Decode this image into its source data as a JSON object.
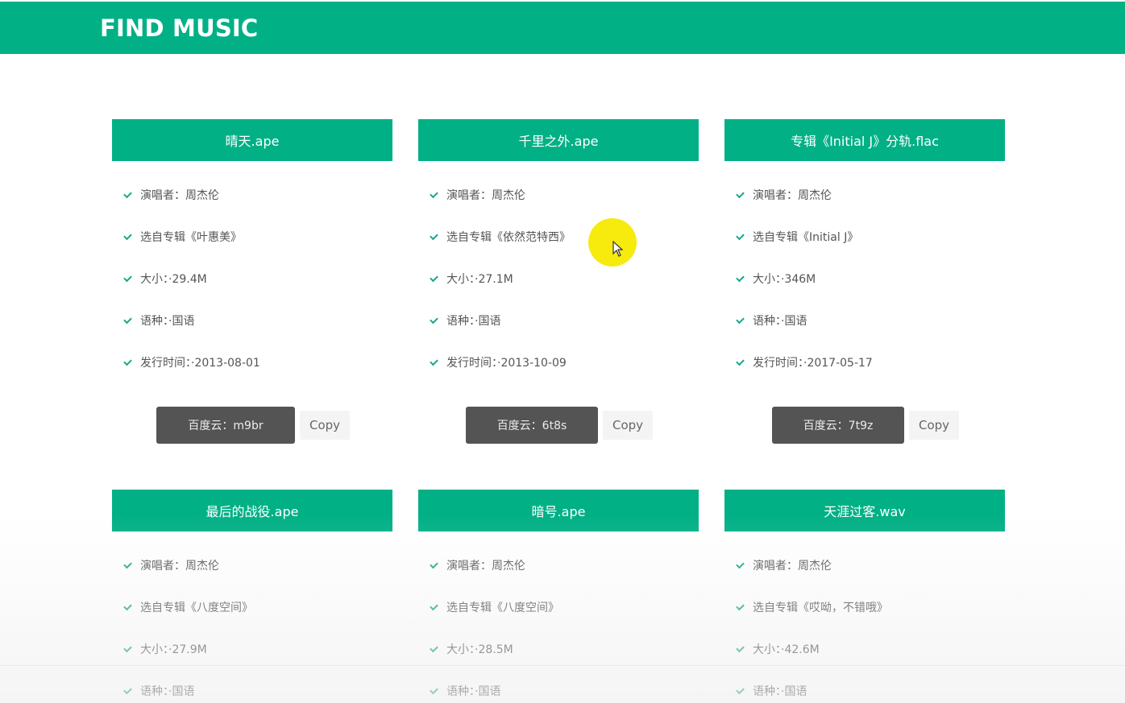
{
  "header": {
    "title": "FIND MUSIC"
  },
  "labels": {
    "singer": "演唱者：",
    "album_prefix": "选自专辑",
    "size": "大小：",
    "language": "语种：",
    "release": "发行时间：",
    "pan": "百度云：",
    "copy": "Copy"
  },
  "cards": [
    {
      "title": "晴天.ape",
      "singer": "演唱者：周杰伦",
      "album": "选自专辑《叶惠美》",
      "size": "大小：·29.4M",
      "language": "语种：·国语",
      "release": "发行时间：·2013-08-01",
      "pan_code": "百度云：m9br",
      "copy_label": "Copy"
    },
    {
      "title": "千里之外.ape",
      "singer": "演唱者：周杰伦",
      "album": "选自专辑《依然范特西》",
      "size": "大小：·27.1M",
      "language": "语种：·国语",
      "release": "发行时间：·2013-10-09",
      "pan_code": "百度云：6t8s",
      "copy_label": "Copy"
    },
    {
      "title": "专辑《Initial J》分轨.flac",
      "singer": "演唱者：周杰伦",
      "album": "选自专辑《Initial J》",
      "size": "大小：·346M",
      "language": "语种：·国语",
      "release": "发行时间：·2017-05-17",
      "pan_code": "百度云：7t9z",
      "copy_label": "Copy"
    },
    {
      "title": "最后的战役.ape",
      "singer": "演唱者：周杰伦",
      "album": "选自专辑《八度空间》",
      "size": "大小：·27.9M",
      "language": "语种：·国语"
    },
    {
      "title": "暗号.ape",
      "singer": "演唱者：周杰伦",
      "album": "选自专辑《八度空间》",
      "size": "大小：·28.5M",
      "language": "语种：·国语"
    },
    {
      "title": "天涯过客.wav",
      "singer": "演唱者：周杰伦",
      "album": "选自专辑《哎呦，不错哦》",
      "size": "大小：·42.6M",
      "language": "语种：·国语"
    }
  ],
  "accent_color": "#02b086",
  "button_color": "#545454"
}
